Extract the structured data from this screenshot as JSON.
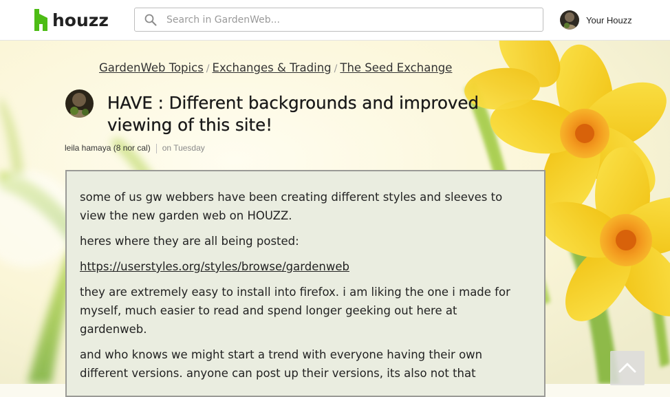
{
  "header": {
    "logo_text": "houzz",
    "search_placeholder": "Search in GardenWeb...",
    "profile_label": "Your Houzz"
  },
  "breadcrumb": {
    "items": [
      "GardenWeb Topics",
      "Exchanges & Trading",
      "The Seed Exchange"
    ],
    "separator": "/"
  },
  "post": {
    "title": "HAVE : Different backgrounds and improved viewing of this site!",
    "author": "leila hamaya (8 nor cal)",
    "date": "on Tuesday",
    "paragraphs": [
      "some of us gw webbers have been creating different styles and sleeves to view the new garden web on HOUZZ.",
      "heres where they are all being posted:",
      "https://userstyles.org/styles/browse/gardenweb",
      "they are extremely easy to install into firefox. i am liking the one i made for myself, much easier to read and spend longer geeking out here at gardenweb.",
      "and who knows we might start a trend with everyone having their own different versions. anyone can post up their versions, its also not that"
    ]
  },
  "icons": {
    "logo": "houzz-logo-icon",
    "search": "search-icon",
    "scroll_top": "chevron-up-icon"
  },
  "colors": {
    "brand_green": "#4dbc15",
    "post_background": "#eaede0",
    "flower_yellow": "#f5d21c",
    "flower_orange": "#f3921b"
  }
}
